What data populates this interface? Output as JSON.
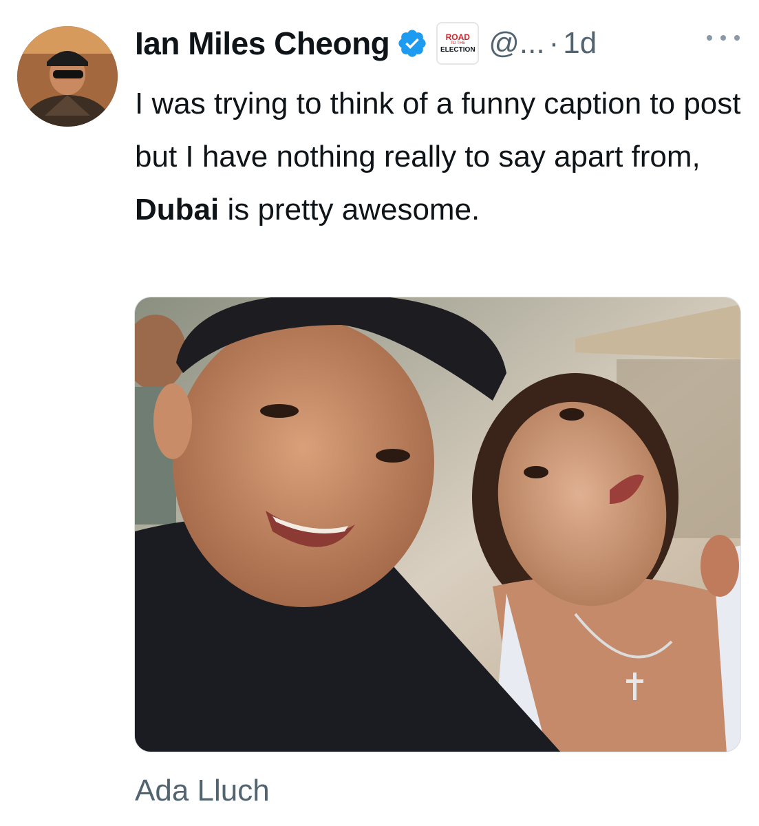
{
  "tweet": {
    "author_name": "Ian Miles Cheong",
    "handle": "@...",
    "separator": "·",
    "time": "1d",
    "affiliate_badge": {
      "line1": "ROAD",
      "line2": "TO THE",
      "line3": "ELECTION"
    },
    "text_part1": "I was trying to think of a funny caption to post but I have nothing really to say apart from, ",
    "text_bold": "Dubai",
    "text_part2": " is pretty awesome.",
    "media_caption": "Ada Lluch"
  },
  "icons": {
    "verified": "verified-badge-icon",
    "more": "more-options-icon"
  },
  "colors": {
    "text": "#0f1419",
    "secondary": "#536471",
    "verified_blue": "#1d9bf0",
    "badge_red": "#d8222a"
  }
}
